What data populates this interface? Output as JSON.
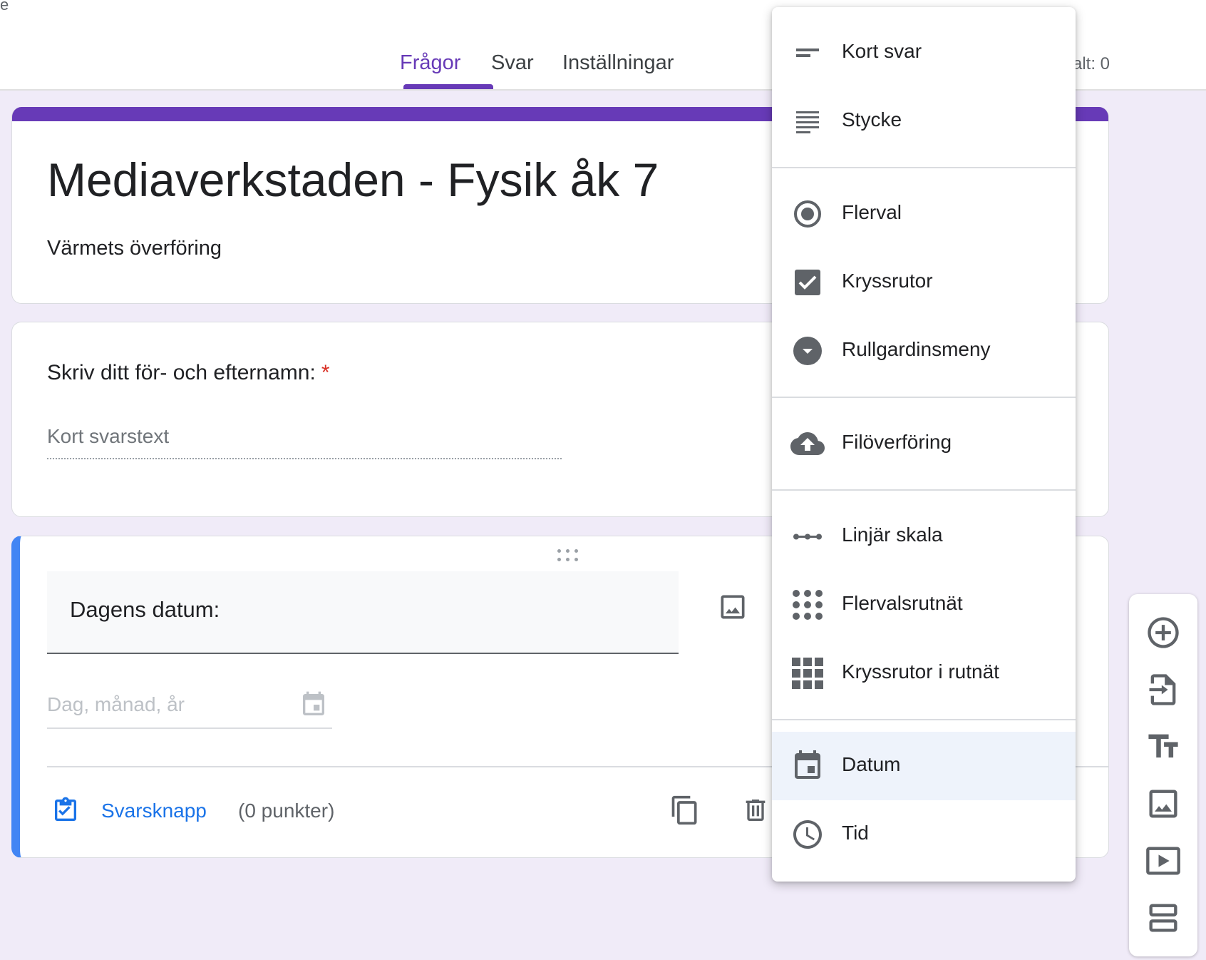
{
  "header": {
    "corner_text": "e",
    "tabs": [
      {
        "label": "Frågor",
        "active": true
      },
      {
        "label": "Svar",
        "active": false
      },
      {
        "label": "Inställningar",
        "active": false
      }
    ],
    "total_points_partial": "alt: 0"
  },
  "form": {
    "title": "Mediaverkstaden - Fysik åk 7",
    "description": "Värmets överföring"
  },
  "question1": {
    "title": "Skriv ditt för- och efternamn:",
    "required_marker": "*",
    "input_placeholder": "Kort svarstext"
  },
  "question2": {
    "title": "Dagens datum:",
    "date_placeholder": "Dag, månad, år",
    "answer_key_label": "Svarsknapp",
    "points_label": "(0 punkter)"
  },
  "type_menu": {
    "selected": "Datum",
    "items": [
      {
        "label": "Kort svar",
        "icon": "short-text-icon"
      },
      {
        "label": "Stycke",
        "icon": "paragraph-icon"
      },
      {
        "label": "Flerval",
        "icon": "radio-icon"
      },
      {
        "label": "Kryssrutor",
        "icon": "checkbox-icon"
      },
      {
        "label": "Rullgardinsmeny",
        "icon": "dropdown-icon"
      },
      {
        "label": "Filöverföring",
        "icon": "cloud-upload-icon"
      },
      {
        "label": "Linjär skala",
        "icon": "linear-scale-icon"
      },
      {
        "label": "Flervalsrutnät",
        "icon": "grid-dots-icon"
      },
      {
        "label": "Kryssrutor i rutnät",
        "icon": "grid-squares-icon"
      },
      {
        "label": "Datum",
        "icon": "calendar-icon"
      },
      {
        "label": "Tid",
        "icon": "clock-icon"
      }
    ]
  },
  "toolbar": {
    "buttons": [
      "add-question-icon",
      "import-questions-icon",
      "add-title-icon",
      "add-image-icon",
      "add-video-icon",
      "add-section-icon"
    ]
  },
  "colors": {
    "accent": "#673ab7",
    "background": "#f0ebf8",
    "active_card_border": "#4285f4",
    "link": "#1a73e8",
    "required": "#d93025",
    "icon": "#5f6368"
  }
}
